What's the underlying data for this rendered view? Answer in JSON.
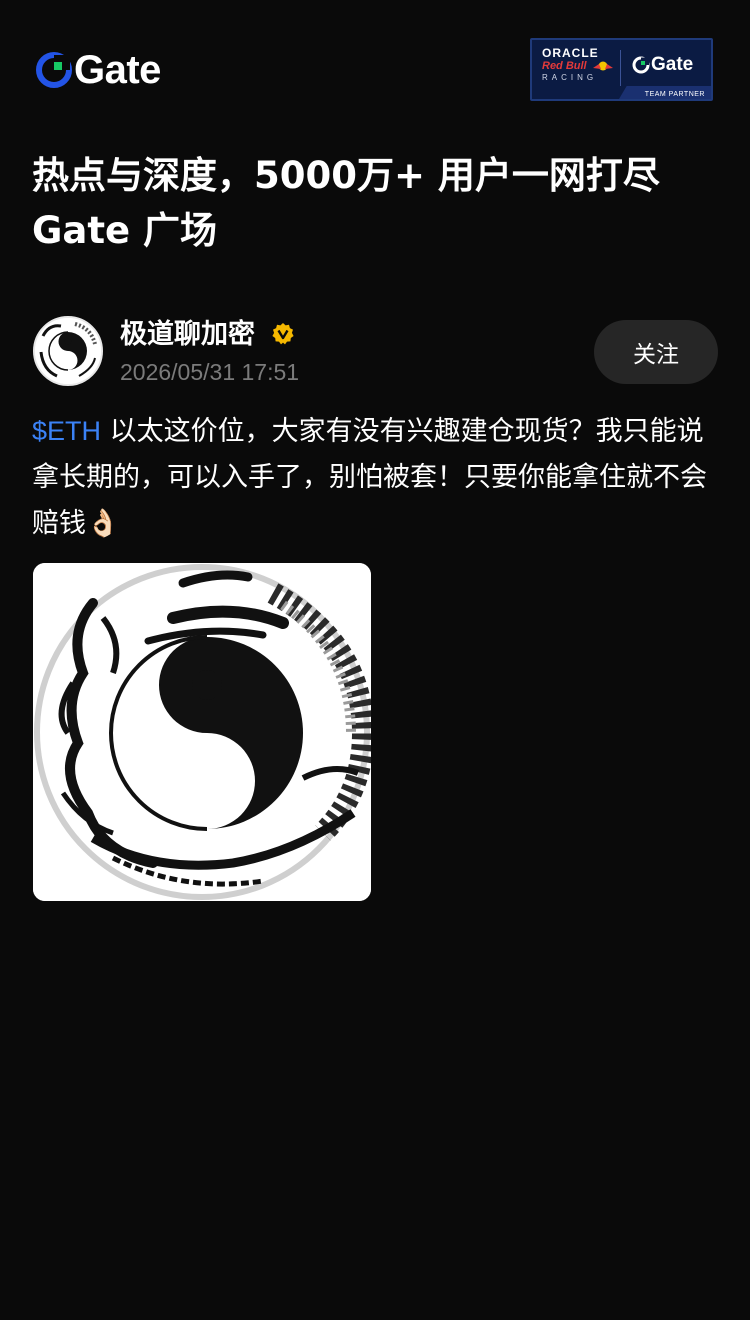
{
  "brand": {
    "name": "Gate",
    "accent": "#2354e6",
    "accent_green": "#17c964"
  },
  "partner_badge": {
    "line1": "ORACLE",
    "line2": "Red Bull",
    "line3": "RACING",
    "partner_name": "Gate",
    "footer": "TEAM PARTNER"
  },
  "headline": {
    "line1": "热点与深度，5000万+ 用户一网打尽",
    "line2": "Gate 广场"
  },
  "post": {
    "author": "极道聊加密",
    "timestamp": "2026/05/31 17:51",
    "follow_label": "关注",
    "ticker": "$ETH",
    "text": " 以太这价位，大家有没有兴趣建仓现货？我只能说拿长期的，可以入手了，别怕被套！只要你能拿住就不会赔钱👌🏻",
    "image_icon": "yin-yang-dragon-image"
  },
  "colors": {
    "background": "#0a0a0a",
    "link": "#3b82f6",
    "muted": "#7b7b7b",
    "button": "#262626",
    "verified": "#f5b800"
  }
}
